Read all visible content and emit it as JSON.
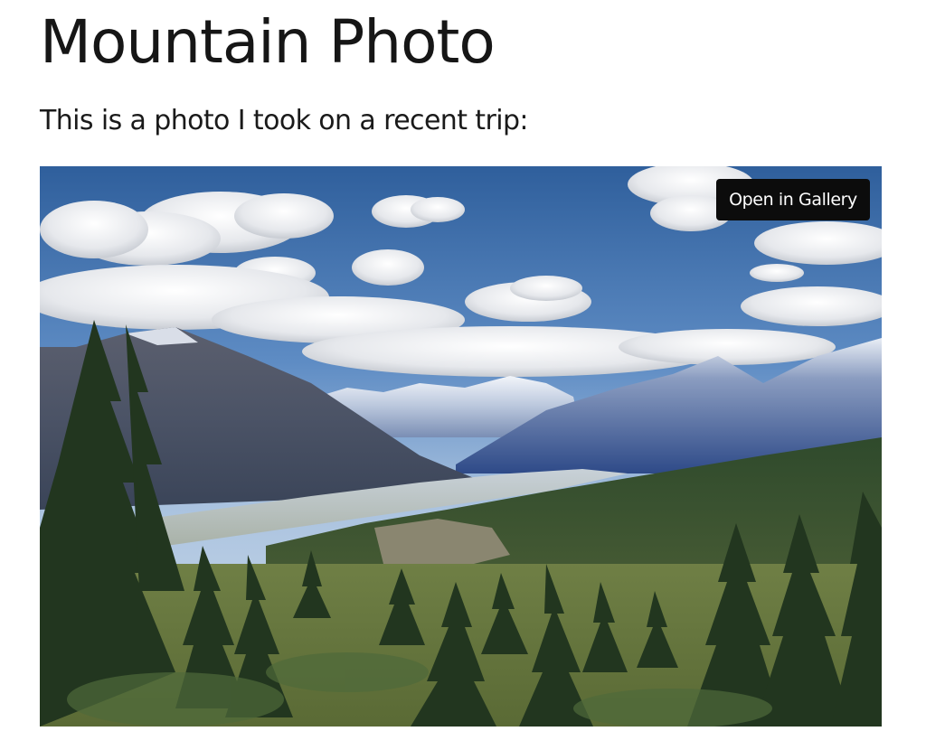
{
  "page": {
    "title": "Mountain Photo",
    "intro": "This is a photo I took on a recent trip:"
  },
  "photo": {
    "subject": "mountain landscape",
    "gallery_button_label": "Open in Gallery"
  },
  "colors": {
    "sky": "#4a78b0",
    "button_background": "#0c0c0c",
    "button_text": "#ffffff"
  }
}
